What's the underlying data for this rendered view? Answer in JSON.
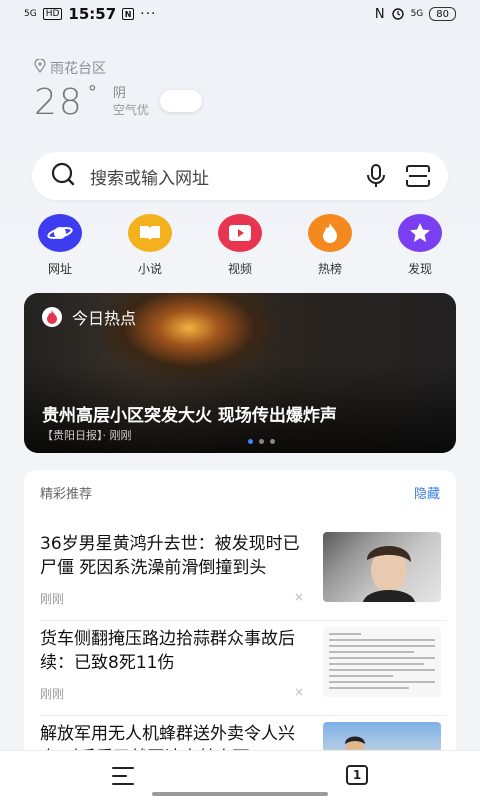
{
  "status_bar": {
    "signal": "5G",
    "hd": "HD",
    "time": "15:57",
    "nfc": "N",
    "more": "···",
    "right_signal": "5G",
    "battery": "80"
  },
  "location": "雨花台区",
  "weather": {
    "temperature": "28",
    "degree": "°",
    "condition": "阴",
    "air": "空气优"
  },
  "search": {
    "placeholder": "搜索或输入网址"
  },
  "quick_links": [
    {
      "label": "网址",
      "icon": "planet-icon",
      "color": "#3d3cf0"
    },
    {
      "label": "小说",
      "icon": "book-icon",
      "color": "#f2b11d"
    },
    {
      "label": "视频",
      "icon": "play-icon",
      "color": "#e8354f"
    },
    {
      "label": "热榜",
      "icon": "flame-icon",
      "color": "#f48a1f"
    },
    {
      "label": "发现",
      "icon": "star-icon",
      "color": "#7a3ff0"
    }
  ],
  "hot_card": {
    "tag": "今日热点",
    "headline": "贵州高层小区突发大火  现场传出爆炸声",
    "source": "【贵阳日报】· 刚刚",
    "pages": 3,
    "active_page": 1
  },
  "feed": {
    "title": "精彩推荐",
    "hide": "隐藏",
    "items": [
      {
        "title": "36岁男星黄鸿升去世：被发现时已尸僵 死因系洗澡前滑倒撞到头",
        "time": "刚刚",
        "close": "×"
      },
      {
        "title": "货车侧翻掩压路边拾蒜群众事故后续：已致8死11伤",
        "time": "刚刚",
        "close": "×"
      },
      {
        "title": "解放军用无人机蜂群送外卖令人兴奋 对手看了就要读出其中而",
        "time": "",
        "close": ""
      }
    ]
  },
  "bottom_bar": {
    "tab_count": "1"
  }
}
